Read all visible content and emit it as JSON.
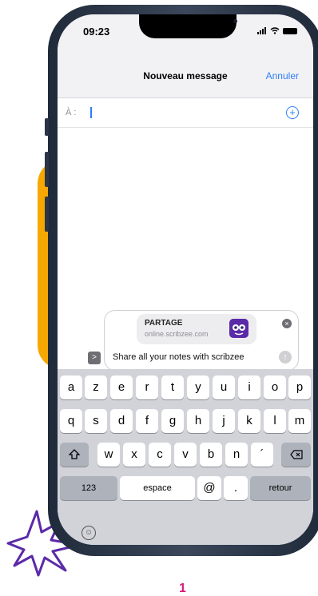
{
  "status": {
    "time": "09:23"
  },
  "nav": {
    "title": "Nouveau message",
    "cancel_label": "Annuler"
  },
  "recipient": {
    "label": "À :",
    "add_icon": "plus-circle-icon"
  },
  "link_preview": {
    "title": "PARTAGE",
    "url": "online.scribzee.com"
  },
  "compose": {
    "text": "Share all your notes with scribzee"
  },
  "keyboard": {
    "row1": [
      "a",
      "z",
      "e",
      "r",
      "t",
      "y",
      "u",
      "i",
      "o",
      "p"
    ],
    "row2": [
      "q",
      "s",
      "d",
      "f",
      "g",
      "h",
      "j",
      "k",
      "l",
      "m"
    ],
    "row3": [
      "w",
      "x",
      "c",
      "v",
      "b",
      "n",
      "´"
    ],
    "numbers_label": "123",
    "space_label": "espace",
    "at_label": "@",
    "dot_label": ".",
    "return_label": "retour"
  },
  "step_number": "1",
  "colors": {
    "accent": "#2f7ef6",
    "orange": "#f7a800",
    "purple": "#5b2aa8",
    "pink": "#d6197c"
  }
}
